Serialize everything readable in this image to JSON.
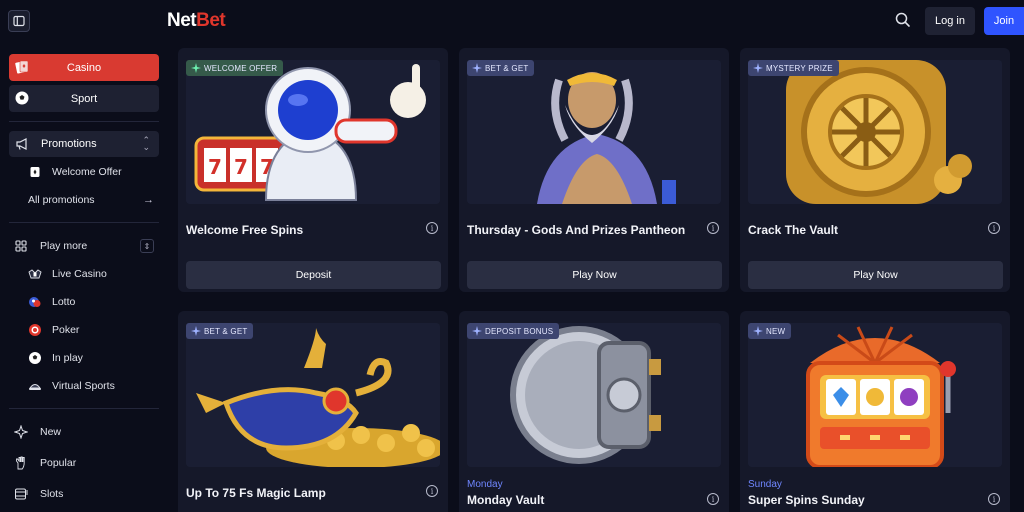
{
  "header": {
    "logo_net": "Net",
    "logo_bet": "Bet",
    "login_label": "Log in",
    "join_label": "Join"
  },
  "sidebar": {
    "casino_label": "Casino",
    "sport_label": "Sport",
    "promotions_label": "Promotions",
    "welcome_offer_label": "Welcome Offer",
    "all_promotions_label": "All promotions",
    "play_more_label": "Play more",
    "play_more_items": [
      {
        "label": "Live Casino",
        "icon": "live-casino-icon"
      },
      {
        "label": "Lotto",
        "icon": "lotto-icon"
      },
      {
        "label": "Poker",
        "icon": "poker-chip-icon"
      },
      {
        "label": "In play",
        "icon": "soccer-ball-icon"
      },
      {
        "label": "Virtual Sports",
        "icon": "virtual-sports-icon"
      }
    ],
    "bottom_items": [
      {
        "label": "New",
        "icon": "sparkle-icon"
      },
      {
        "label": "Popular",
        "icon": "popular-hand-icon"
      },
      {
        "label": "Slots",
        "icon": "slots-icon"
      }
    ]
  },
  "cards": [
    {
      "badge": "WELCOME OFFER",
      "title": "Welcome Free Spins",
      "button": "Deposit"
    },
    {
      "badge": "BET & GET",
      "title": "Thursday - Gods And Prizes Pantheon",
      "button": "Play Now"
    },
    {
      "badge": "MYSTERY PRIZE",
      "title": "Crack The Vault",
      "button": "Play Now"
    },
    {
      "badge": "BET & GET",
      "title": "Up To 75 Fs Magic Lamp"
    },
    {
      "badge": "DEPOSIT BONUS",
      "day": "Monday",
      "title": "Monday Vault"
    },
    {
      "badge": "NEW",
      "day": "Sunday",
      "title": "Super Spins Sunday"
    }
  ],
  "colors": {
    "accent_red": "#d93a31",
    "join_blue": "#2f54ff",
    "background": "#0b0d1a",
    "card": "#151829",
    "day_blue": "#6f86ff"
  }
}
